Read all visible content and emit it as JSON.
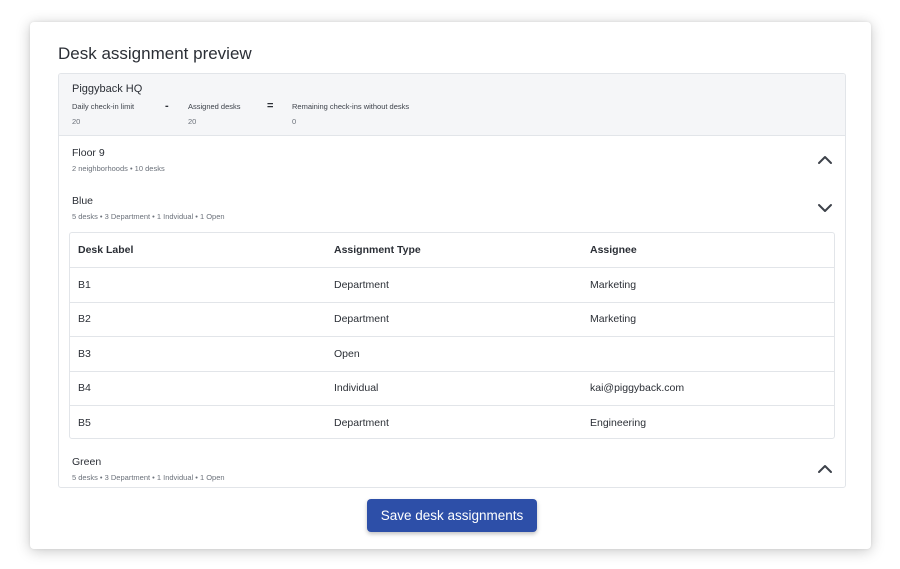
{
  "page": {
    "title": "Desk assignment preview"
  },
  "location": {
    "name": "Piggyback HQ",
    "metrics": [
      {
        "label": "Daily check-in limit",
        "value": "20"
      },
      {
        "label": "Assigned desks",
        "value": "20"
      },
      {
        "label": "Remaining check-ins without desks",
        "value": "0"
      }
    ],
    "operators": [
      "-",
      "="
    ]
  },
  "floor": {
    "name": "Floor 9",
    "summary": "2 neighborhoods • 10 desks",
    "chevron_icon": "chevron-up-icon"
  },
  "neighborhoods": [
    {
      "name": "Blue",
      "summary": "5 desks • 3 Department • 1 Indvidual • 1 Open",
      "chevron_icon": "chevron-down-icon"
    },
    {
      "name": "Green",
      "summary": "5 desks • 3 Department • 1 Indvidual • 1 Open",
      "chevron_icon": "chevron-up-icon"
    }
  ],
  "table": {
    "headers": [
      "Desk Label",
      "Assignment Type",
      "Assignee"
    ],
    "rows": [
      [
        "B1",
        "Department",
        "Marketing"
      ],
      [
        "B2",
        "Department",
        "Marketing"
      ],
      [
        "B3",
        "Open",
        ""
      ],
      [
        "B4",
        "Individual",
        "kai@piggyback.com"
      ],
      [
        "B5",
        "Department",
        "Engineering"
      ]
    ]
  },
  "actions": {
    "save_label": "Save desk assignments"
  },
  "colors": {
    "primary_button": "#2d4fa8",
    "summary_bg": "#f5f6f8",
    "border": "#e2e5e9"
  }
}
